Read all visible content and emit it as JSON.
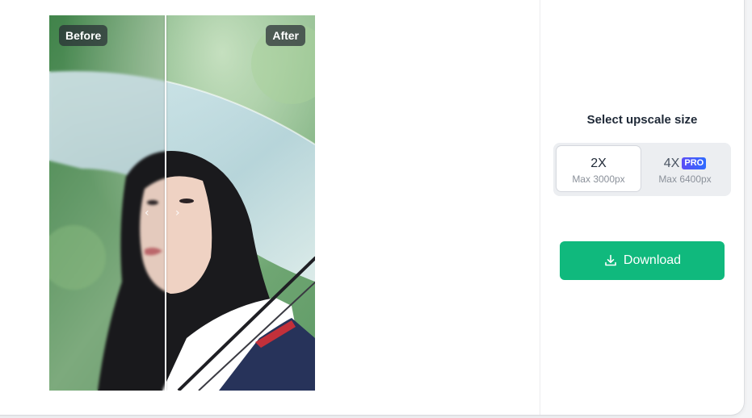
{
  "preview": {
    "before_label": "Before",
    "after_label": "After"
  },
  "panel": {
    "title": "Select upscale size",
    "options": [
      {
        "label": "2X",
        "sub": "Max 3000px",
        "selected": true
      },
      {
        "label": "4X",
        "sub": "Max 6400px",
        "badge": "PRO",
        "selected": false
      }
    ],
    "download_label": "Download"
  },
  "colors": {
    "accent": "#10b97d",
    "pro_badge": "#3b5bff"
  },
  "icons": {
    "download": "download-icon",
    "split_handle": "chevron-left-right-icon"
  }
}
